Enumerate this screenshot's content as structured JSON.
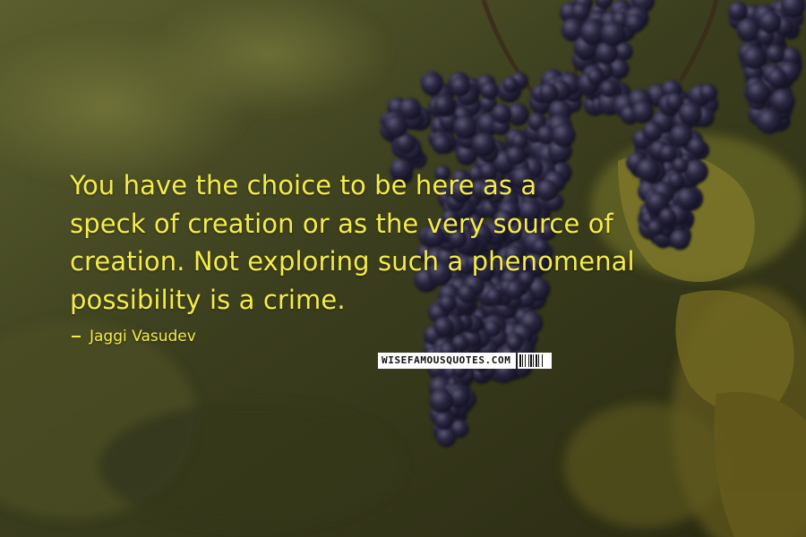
{
  "quote": {
    "lines": [
      "You have the choice to be here as a",
      "speck of creation or as the very source of",
      "creation. Not exploring such a phenomenal",
      "possibility is a crime."
    ]
  },
  "author": {
    "name": "Jaggi Vasudev"
  },
  "watermark": {
    "text": "WISEFAMOUSQUOTES.COM"
  },
  "colors": {
    "text": "#f5ec48",
    "grape": "#1e1c2e",
    "leaf": "#6f6a22"
  },
  "icons": {
    "author_marker": "dash-icon",
    "watermark_code": "barcode-icon"
  }
}
